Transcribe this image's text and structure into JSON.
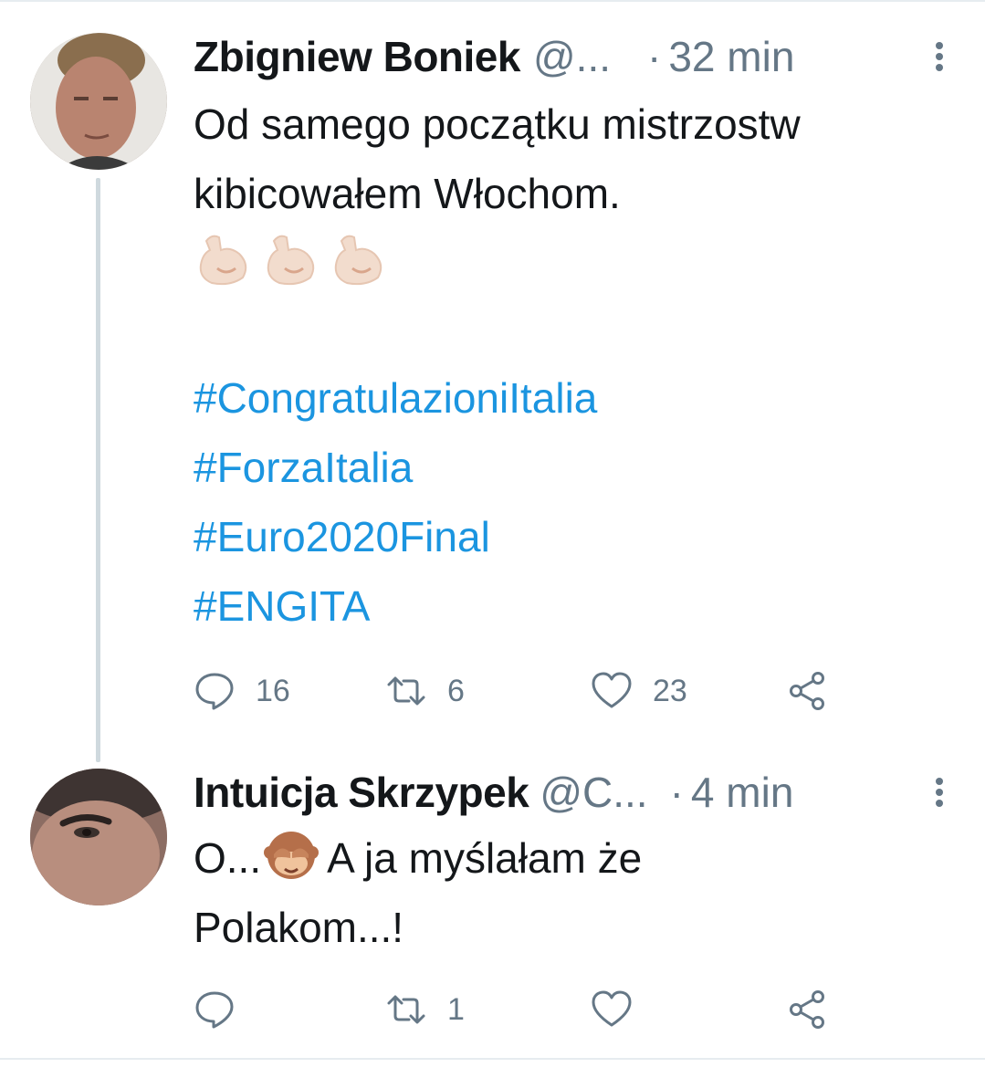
{
  "tweets": [
    {
      "author": {
        "display_name": "Zbigniew Boniek",
        "handle": "@..."
      },
      "separator": "·",
      "time": "32 min",
      "text_lines": [
        "Od samego początku mistrzostw",
        "kibicowałem Włochom."
      ],
      "emoji": [
        "flexed-biceps",
        "flexed-biceps",
        "flexed-biceps"
      ],
      "hashtags": [
        "#CongratulazioniItalia",
        "#ForzaItalia",
        "#Euro2020Final",
        "#ENGITA"
      ],
      "actions": {
        "replies": "16",
        "retweets": "6",
        "likes": "23"
      }
    },
    {
      "author": {
        "display_name": "Intuicja Skrzypek",
        "handle": "@C..."
      },
      "separator": "·",
      "time": "4 min",
      "text_line_1_prefix": "O...",
      "text_line_1_emoji": "see-no-evil-monkey",
      "text_line_1_suffix": "A ja myślałam że",
      "text_line_2": "Polakom...!",
      "actions": {
        "replies": "",
        "retweets": "1",
        "likes": ""
      }
    }
  ],
  "colors": {
    "text": "#14171a",
    "secondary": "#657786",
    "link": "#1b95e0",
    "divider": "#e6ecf0",
    "thread_line": "#cfd9de"
  }
}
